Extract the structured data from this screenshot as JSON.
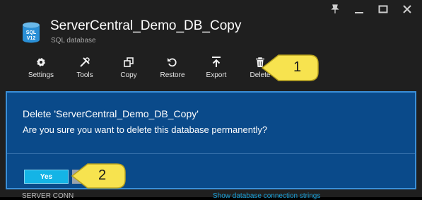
{
  "window": {
    "controls": [
      {
        "name": "pin-icon"
      },
      {
        "name": "minimize-icon"
      },
      {
        "name": "maximize-icon"
      },
      {
        "name": "close-icon"
      }
    ]
  },
  "header": {
    "icon_lines": [
      "SQL",
      "V12"
    ],
    "title": "ServerCentral_Demo_DB_Copy",
    "subtitle": "SQL database"
  },
  "toolbar": {
    "items": [
      {
        "label": "Settings",
        "icon": "gear-icon"
      },
      {
        "label": "Tools",
        "icon": "tools-icon"
      },
      {
        "label": "Copy",
        "icon": "copy-icon"
      },
      {
        "label": "Restore",
        "icon": "restore-icon"
      },
      {
        "label": "Export",
        "icon": "export-icon"
      },
      {
        "label": "Delete",
        "icon": "trash-icon"
      }
    ]
  },
  "dialog": {
    "title": "Delete 'ServerCentral_Demo_DB_Copy'",
    "message": "Are you sure you want to delete this database permanently?",
    "yes_label": "Yes"
  },
  "footer": {
    "left_text": "SERVER CONN",
    "right_text": "Show database connection strings"
  },
  "callouts": [
    {
      "number": "1",
      "points_to": "Delete"
    },
    {
      "number": "2",
      "points_to": "No"
    }
  ],
  "colors": {
    "blade_bg": "#1f1f1f",
    "dialog_bg": "#0a4a8a",
    "dialog_border": "#3a8fd8",
    "yes_button": "#14b4e6",
    "callout_fill": "#f7e34f",
    "link": "#1aa0d8"
  }
}
